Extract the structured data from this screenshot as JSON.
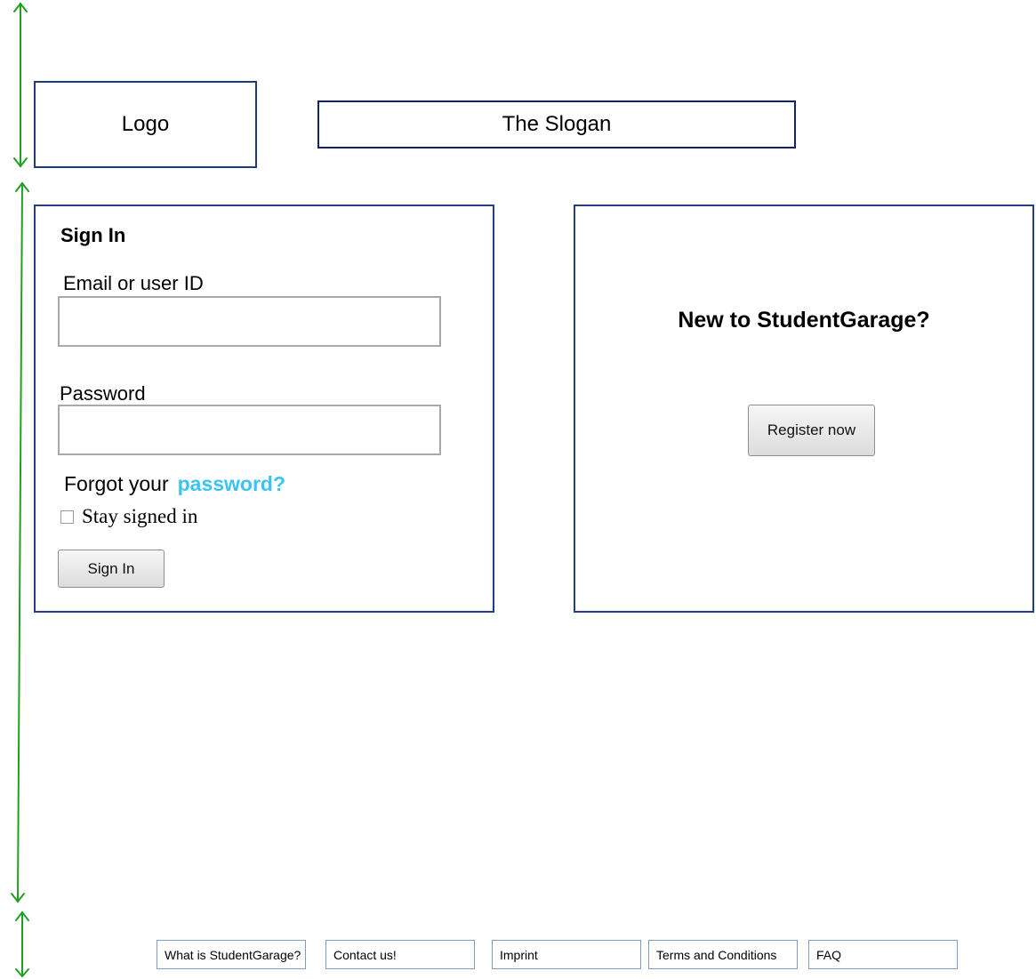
{
  "header": {
    "logo_text": "Logo",
    "slogan_text": "The Slogan"
  },
  "signin": {
    "title": "Sign In",
    "email_label": "Email or user ID",
    "email_value": "",
    "password_label": "Password",
    "password_value": "",
    "forgot_prefix": "Forgot your",
    "forgot_link": "password?",
    "stay_signed_in": "Stay signed in",
    "stay_signed_in_checked": false,
    "button_label": "Sign In"
  },
  "register": {
    "title": "New to StudentGarage?",
    "button_label": "Register now"
  },
  "footer": {
    "links": [
      {
        "label": "What is StudentGarage?"
      },
      {
        "label": "Contact us!"
      },
      {
        "label": "Imprint"
      },
      {
        "label": "Terms and Conditions"
      },
      {
        "label": "FAQ"
      }
    ]
  },
  "colors": {
    "panel_border": "#233f83",
    "link_blue": "#3cc3f5",
    "guide_green": "#1fa01f"
  }
}
